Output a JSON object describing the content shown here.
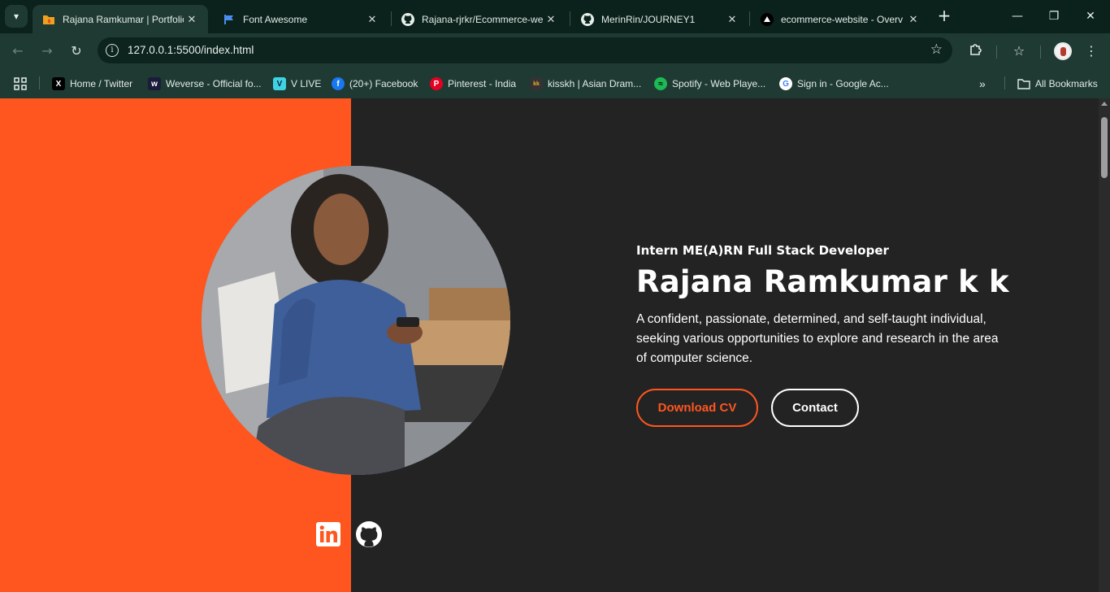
{
  "browser": {
    "tabs": [
      {
        "title": "Rajana Ramkumar | Portfolio",
        "icon": "folder-flame-icon",
        "active": true
      },
      {
        "title": "Font Awesome",
        "icon": "flag-icon",
        "active": false
      },
      {
        "title": "Rajana-rjrkr/Ecommerce-wel",
        "icon": "github-icon",
        "active": false
      },
      {
        "title": "MerinRin/JOURNEY1",
        "icon": "github-icon",
        "active": false
      },
      {
        "title": "ecommerce-website - Overv",
        "icon": "vercel-icon",
        "active": false
      }
    ],
    "url": "127.0.0.1:5500/index.html",
    "bookmarks": [
      {
        "label": "Home / Twitter",
        "icon": "x-icon",
        "color": "#000000"
      },
      {
        "label": "Weverse - Official fo...",
        "icon": "weverse-icon",
        "color": "#1b1b3a"
      },
      {
        "label": "V LIVE",
        "icon": "vlive-icon",
        "color": "#3ed3e4"
      },
      {
        "label": "(20+) Facebook",
        "icon": "facebook-icon",
        "color": "#1877f2"
      },
      {
        "label": "Pinterest - India",
        "icon": "pinterest-icon",
        "color": "#e60023"
      },
      {
        "label": "kisskh | Asian Dram...",
        "icon": "kisskh-icon",
        "color": "#333333"
      },
      {
        "label": "Spotify - Web Playe...",
        "icon": "spotify-icon",
        "color": "#1db954"
      },
      {
        "label": "Sign in - Google Ac...",
        "icon": "google-icon",
        "color": "#ffffff"
      }
    ],
    "all_bookmarks": "All Bookmarks"
  },
  "hero": {
    "role": "Intern ME(A)RN Full Stack Developer",
    "name": "Rajana Ramkumar k k",
    "description": "A confident, passionate, determined, and self-taught individual, seeking various opportunities to explore and research in the area of computer science.",
    "download_cv": "Download CV",
    "contact": "Contact"
  },
  "colors": {
    "accent": "#ff561f",
    "page_bg": "#232323",
    "chrome_bg": "#1f3a33"
  }
}
